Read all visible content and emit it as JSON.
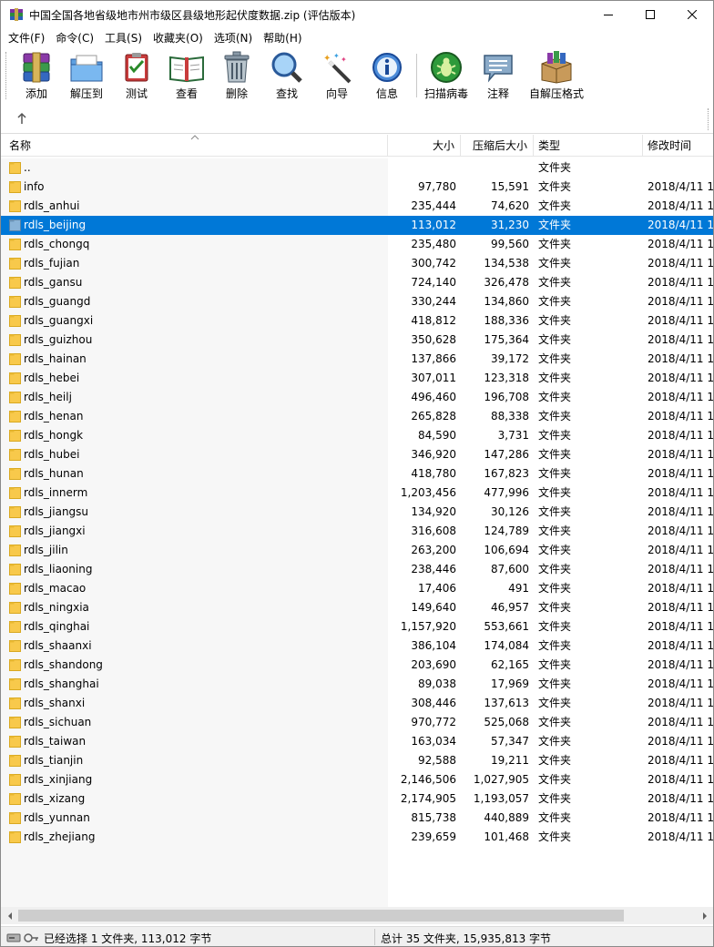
{
  "window": {
    "title": "中国全国各地省级地市州市级区县级地形起伏度数据.zip (评估版本)"
  },
  "menu": [
    "文件(F)",
    "命令(C)",
    "工具(S)",
    "收藏夹(O)",
    "选项(N)",
    "帮助(H)"
  ],
  "toolbar": [
    {
      "label": "添加",
      "icon": "add-archive-icon"
    },
    {
      "label": "解压到",
      "icon": "extract-to-icon"
    },
    {
      "label": "测试",
      "icon": "test-icon"
    },
    {
      "label": "查看",
      "icon": "view-icon"
    },
    {
      "label": "删除",
      "icon": "delete-icon"
    },
    {
      "label": "查找",
      "icon": "find-icon"
    },
    {
      "label": "向导",
      "icon": "wizard-icon"
    },
    {
      "label": "信息",
      "icon": "info-icon"
    },
    {
      "label": "扫描病毒",
      "icon": "virus-scan-icon"
    },
    {
      "label": "注释",
      "icon": "comment-icon"
    },
    {
      "label": "自解压格式",
      "icon": "sfx-icon"
    }
  ],
  "columns": {
    "name": "名称",
    "size": "大小",
    "packed": "压缩后大小",
    "type": "类型",
    "mtime": "修改时间"
  },
  "rows": [
    {
      "name": "..",
      "size": "",
      "packed": "",
      "type": "文件夹",
      "mtime": ""
    },
    {
      "name": "info",
      "size": "97,780",
      "packed": "15,591",
      "type": "文件夹",
      "mtime": "2018/4/11 1"
    },
    {
      "name": "rdls_anhui",
      "size": "235,444",
      "packed": "74,620",
      "type": "文件夹",
      "mtime": "2018/4/11 1"
    },
    {
      "name": "rdls_beijing",
      "size": "113,012",
      "packed": "31,230",
      "type": "文件夹",
      "mtime": "2018/4/11 1",
      "selected": true
    },
    {
      "name": "rdls_chongq",
      "size": "235,480",
      "packed": "99,560",
      "type": "文件夹",
      "mtime": "2018/4/11 1"
    },
    {
      "name": "rdls_fujian",
      "size": "300,742",
      "packed": "134,538",
      "type": "文件夹",
      "mtime": "2018/4/11 1"
    },
    {
      "name": "rdls_gansu",
      "size": "724,140",
      "packed": "326,478",
      "type": "文件夹",
      "mtime": "2018/4/11 1"
    },
    {
      "name": "rdls_guangd",
      "size": "330,244",
      "packed": "134,860",
      "type": "文件夹",
      "mtime": "2018/4/11 1"
    },
    {
      "name": "rdls_guangxi",
      "size": "418,812",
      "packed": "188,336",
      "type": "文件夹",
      "mtime": "2018/4/11 1"
    },
    {
      "name": "rdls_guizhou",
      "size": "350,628",
      "packed": "175,364",
      "type": "文件夹",
      "mtime": "2018/4/11 1"
    },
    {
      "name": "rdls_hainan",
      "size": "137,866",
      "packed": "39,172",
      "type": "文件夹",
      "mtime": "2018/4/11 1"
    },
    {
      "name": "rdls_hebei",
      "size": "307,011",
      "packed": "123,318",
      "type": "文件夹",
      "mtime": "2018/4/11 1"
    },
    {
      "name": "rdls_heilj",
      "size": "496,460",
      "packed": "196,708",
      "type": "文件夹",
      "mtime": "2018/4/11 1"
    },
    {
      "name": "rdls_henan",
      "size": "265,828",
      "packed": "88,338",
      "type": "文件夹",
      "mtime": "2018/4/11 1"
    },
    {
      "name": "rdls_hongk",
      "size": "84,590",
      "packed": "3,731",
      "type": "文件夹",
      "mtime": "2018/4/11 1"
    },
    {
      "name": "rdls_hubei",
      "size": "346,920",
      "packed": "147,286",
      "type": "文件夹",
      "mtime": "2018/4/11 1"
    },
    {
      "name": "rdls_hunan",
      "size": "418,780",
      "packed": "167,823",
      "type": "文件夹",
      "mtime": "2018/4/11 1"
    },
    {
      "name": "rdls_innerm",
      "size": "1,203,456",
      "packed": "477,996",
      "type": "文件夹",
      "mtime": "2018/4/11 1"
    },
    {
      "name": "rdls_jiangsu",
      "size": "134,920",
      "packed": "30,126",
      "type": "文件夹",
      "mtime": "2018/4/11 1"
    },
    {
      "name": "rdls_jiangxi",
      "size": "316,608",
      "packed": "124,789",
      "type": "文件夹",
      "mtime": "2018/4/11 1"
    },
    {
      "name": "rdls_jilin",
      "size": "263,200",
      "packed": "106,694",
      "type": "文件夹",
      "mtime": "2018/4/11 1"
    },
    {
      "name": "rdls_liaoning",
      "size": "238,446",
      "packed": "87,600",
      "type": "文件夹",
      "mtime": "2018/4/11 1"
    },
    {
      "name": "rdls_macao",
      "size": "17,406",
      "packed": "491",
      "type": "文件夹",
      "mtime": "2018/4/11 1"
    },
    {
      "name": "rdls_ningxia",
      "size": "149,640",
      "packed": "46,957",
      "type": "文件夹",
      "mtime": "2018/4/11 1"
    },
    {
      "name": "rdls_qinghai",
      "size": "1,157,920",
      "packed": "553,661",
      "type": "文件夹",
      "mtime": "2018/4/11 1"
    },
    {
      "name": "rdls_shaanxi",
      "size": "386,104",
      "packed": "174,084",
      "type": "文件夹",
      "mtime": "2018/4/11 1"
    },
    {
      "name": "rdls_shandong",
      "size": "203,690",
      "packed": "62,165",
      "type": "文件夹",
      "mtime": "2018/4/11 1"
    },
    {
      "name": "rdls_shanghai",
      "size": "89,038",
      "packed": "17,969",
      "type": "文件夹",
      "mtime": "2018/4/11 1"
    },
    {
      "name": "rdls_shanxi",
      "size": "308,446",
      "packed": "137,613",
      "type": "文件夹",
      "mtime": "2018/4/11 1"
    },
    {
      "name": "rdls_sichuan",
      "size": "970,772",
      "packed": "525,068",
      "type": "文件夹",
      "mtime": "2018/4/11 1"
    },
    {
      "name": "rdls_taiwan",
      "size": "163,034",
      "packed": "57,347",
      "type": "文件夹",
      "mtime": "2018/4/11 1"
    },
    {
      "name": "rdls_tianjin",
      "size": "92,588",
      "packed": "19,211",
      "type": "文件夹",
      "mtime": "2018/4/11 1"
    },
    {
      "name": "rdls_xinjiang",
      "size": "2,146,506",
      "packed": "1,027,905",
      "type": "文件夹",
      "mtime": "2018/4/11 1"
    },
    {
      "name": "rdls_xizang",
      "size": "2,174,905",
      "packed": "1,193,057",
      "type": "文件夹",
      "mtime": "2018/4/11 1"
    },
    {
      "name": "rdls_yunnan",
      "size": "815,738",
      "packed": "440,889",
      "type": "文件夹",
      "mtime": "2018/4/11 1"
    },
    {
      "name": "rdls_zhejiang",
      "size": "239,659",
      "packed": "101,468",
      "type": "文件夹",
      "mtime": "2018/4/11 1"
    }
  ],
  "status": {
    "left": "已经选择 1 文件夹, 113,012 字节",
    "right": "总计 35 文件夹, 15,935,813 字节"
  },
  "colors": {
    "selection": "#0078d7",
    "folder": "#f8c94b"
  }
}
